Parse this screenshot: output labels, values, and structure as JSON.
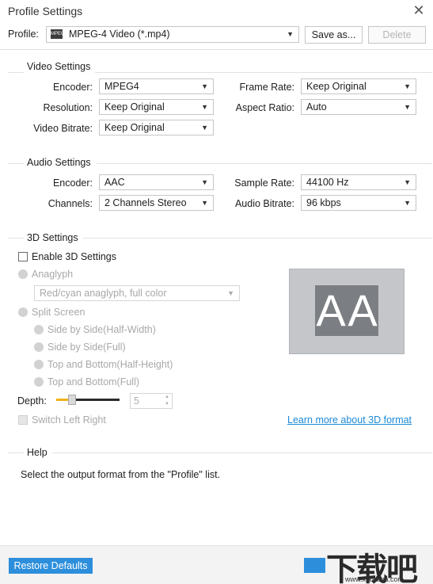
{
  "window": {
    "title": "Profile Settings",
    "close_glyph": "✕"
  },
  "profile": {
    "label": "Profile:",
    "icon": "mpeg4-icon",
    "value": "MPEG-4 Video (*.mp4)",
    "save_label": "Save as...",
    "delete_label": "Delete"
  },
  "video": {
    "title": "Video Settings",
    "encoder_label": "Encoder:",
    "encoder_value": "MPEG4",
    "resolution_label": "Resolution:",
    "resolution_value": "Keep Original",
    "bitrate_label": "Video Bitrate:",
    "bitrate_value": "Keep Original",
    "framerate_label": "Frame Rate:",
    "framerate_value": "Keep Original",
    "aspect_label": "Aspect Ratio:",
    "aspect_value": "Auto"
  },
  "audio": {
    "title": "Audio Settings",
    "encoder_label": "Encoder:",
    "encoder_value": "AAC",
    "channels_label": "Channels:",
    "channels_value": "2 Channels Stereo",
    "samplerate_label": "Sample Rate:",
    "samplerate_value": "44100 Hz",
    "bitrate_label": "Audio Bitrate:",
    "bitrate_value": "96 kbps"
  },
  "three_d": {
    "title": "3D Settings",
    "enable_label": "Enable 3D Settings",
    "enabled": false,
    "anaglyph_label": "Anaglyph",
    "anaglyph_value": "Red/cyan anaglyph, full color",
    "split_label": "Split Screen",
    "split_options": [
      "Side by Side(Half-Width)",
      "Side by Side(Full)",
      "Top and Bottom(Half-Height)",
      "Top and Bottom(Full)"
    ],
    "depth_label": "Depth:",
    "depth_value": "5",
    "depth_fraction": 0.25,
    "switch_label": "Switch Left Right",
    "learn_link": "Learn more about 3D format",
    "preview_letters": [
      "A",
      "A"
    ]
  },
  "help": {
    "title": "Help",
    "text": "Select the output format from the \"Profile\" list."
  },
  "footer": {
    "restore_label": "Restore Defaults",
    "watermark_main": "下载吧",
    "watermark_url": "www.xiazaiba.com"
  },
  "colors": {
    "accent": "#2d8fdc",
    "link": "#1c8ad6",
    "slider": "#f0b21a"
  }
}
